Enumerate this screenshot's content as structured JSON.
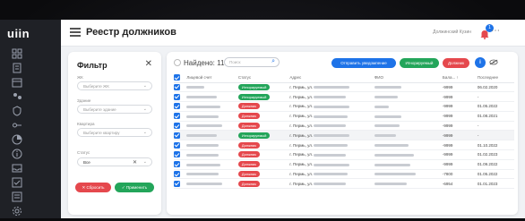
{
  "app": {
    "logo": "uiin",
    "title": "Реестр должников",
    "user_name": "Должинский Кузин",
    "notifications": "1"
  },
  "rail": {
    "icons": [
      "grid-icon",
      "document-icon",
      "calendar-icon",
      "people-icon",
      "shield-icon",
      "key-icon",
      "chart-icon",
      "info-icon",
      "inbox-icon",
      "checklist-icon",
      "report-icon",
      "settings-icon"
    ]
  },
  "filter": {
    "title": "Фильтр",
    "fields": [
      {
        "label": "ЖК",
        "placeholder": "Выберите ЖК"
      },
      {
        "label": "Здание",
        "placeholder": "Выберите здание"
      },
      {
        "label": "Квартира",
        "placeholder": "Выберите квартиру"
      },
      {
        "label": "Статус",
        "value": "Все"
      }
    ],
    "reset_label": "✕ Сбросить",
    "apply_label": "✓ Применить"
  },
  "table": {
    "found_label": "Найдено: 11",
    "search_placeholder": "Поиск",
    "actions": {
      "notify": "Отправить уведомление",
      "ignore": "Игнорируемый",
      "debtor": "Должник",
      "info": "i"
    },
    "columns": [
      "Лицевой счет",
      "Статус",
      "Адрес",
      "ФИО",
      "Бала... ↑",
      "Последнее"
    ],
    "rows": [
      {
        "status": "Игнорируемый",
        "type": "ign",
        "address": "г. Пермь, ул.",
        "balance": "-9999",
        "date": "06.02.2020"
      },
      {
        "status": "Игнорируемый",
        "type": "ign",
        "address": "г. Пермь, ул.",
        "balance": "-9999",
        "date": "-"
      },
      {
        "status": "Должник",
        "type": "dol",
        "address": "г. Пермь, ул.",
        "balance": "-9999",
        "date": "01.05.2022"
      },
      {
        "status": "Должник",
        "type": "dol",
        "address": "г. Пермь, ул.",
        "balance": "-9999",
        "date": "01.08.2021"
      },
      {
        "status": "Должник",
        "type": "dol",
        "address": "г. Пермь, ул.",
        "balance": "-9999",
        "date": "-"
      },
      {
        "status": "Игнорируемый",
        "type": "ign",
        "address": "г. Пермь, ул.",
        "balance": "-9999",
        "date": "-"
      },
      {
        "status": "Должник",
        "type": "dol",
        "address": "г. Пермь, ул.",
        "balance": "-9999",
        "date": "01.10.2022"
      },
      {
        "status": "Должник",
        "type": "dol",
        "address": "г. Пермь, ул.",
        "balance": "-9999",
        "date": "01.02.2023"
      },
      {
        "status": "Должник",
        "type": "dol",
        "address": "г. Пермь, ул.",
        "balance": "-9999",
        "date": "01.09.2022"
      },
      {
        "status": "Должник",
        "type": "dol",
        "address": "г. Пермь, ул.",
        "balance": "-7800",
        "date": "01.05.2022"
      },
      {
        "status": "Должник",
        "type": "dol",
        "address": "г. Пермь, ул.",
        "balance": "-6954",
        "date": "01.01.2023"
      }
    ]
  },
  "colors": {
    "accent": "#1e73e8",
    "ignore": "#23a55a",
    "debtor": "#e5484d"
  }
}
